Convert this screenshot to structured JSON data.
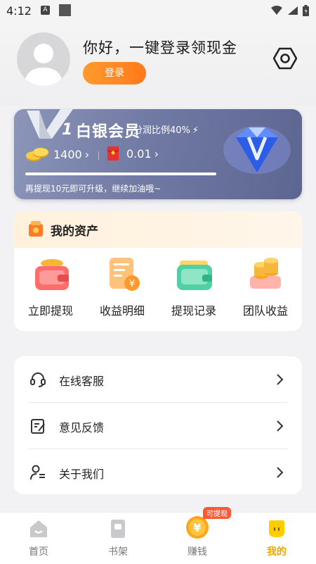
{
  "status_bar": {
    "time": "4:12",
    "notif_icon": "A"
  },
  "profile": {
    "greeting": "你好，一键登录领现金",
    "login_label": "登录"
  },
  "vip_card": {
    "level_num": "1",
    "level_name": "白银会员",
    "ratio_text": "分润比例40%",
    "coins": "1400",
    "cash": "0.01",
    "progress_fraction": 1.0,
    "tip": "再提现10元即可升级，继续加油哦~"
  },
  "assets": {
    "title": "我的资产",
    "items": [
      {
        "label": "立即提现",
        "icon": "wallet-icon"
      },
      {
        "label": "收益明细",
        "icon": "income-detail-icon"
      },
      {
        "label": "提现记录",
        "icon": "withdraw-record-icon"
      },
      {
        "label": "团队收益",
        "icon": "coin-stack-icon"
      }
    ]
  },
  "menu": [
    {
      "label": "在线客服",
      "icon": "headset-icon"
    },
    {
      "label": "意见反馈",
      "icon": "feedback-icon"
    },
    {
      "label": "关于我们",
      "icon": "user-info-icon"
    }
  ],
  "tabs": [
    {
      "label": "首页",
      "icon": "home-icon"
    },
    {
      "label": "书架",
      "icon": "bookshelf-icon"
    },
    {
      "label": "赚钱",
      "icon": "yuan-coin-icon"
    },
    {
      "label": "我的",
      "icon": "mine-icon",
      "active": true
    }
  ],
  "earn_badge": "可提现",
  "colors": {
    "accent": "#ff8a22",
    "active_tab": "#f2a500",
    "vip_card": "#707aa3"
  }
}
